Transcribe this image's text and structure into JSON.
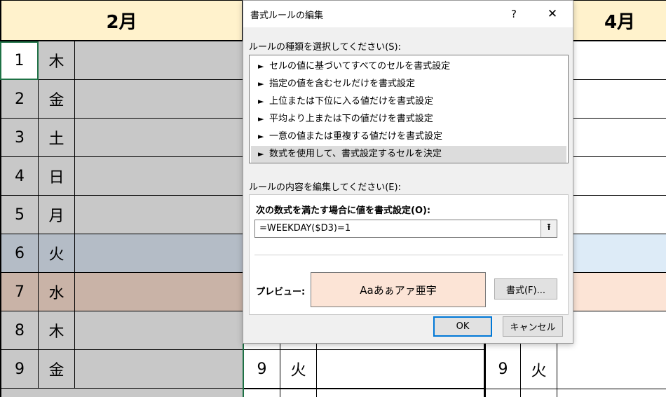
{
  "sheet": {
    "month_left": "2月",
    "month_right": "4月",
    "left_rows": [
      {
        "num": "1",
        "day": "木"
      },
      {
        "num": "2",
        "day": "金"
      },
      {
        "num": "3",
        "day": "土"
      },
      {
        "num": "4",
        "day": "日"
      },
      {
        "num": "5",
        "day": "月"
      },
      {
        "num": "6",
        "day": "火"
      },
      {
        "num": "7",
        "day": "水"
      },
      {
        "num": "8",
        "day": "木"
      },
      {
        "num": "9",
        "day": "金"
      }
    ],
    "mid_row9": {
      "num": "9",
      "day": "火"
    },
    "right_row9": {
      "num": "9",
      "day": "火"
    }
  },
  "dialog": {
    "title": "書式ルールの編集",
    "help": "?",
    "close": "✕",
    "rule_type_label": "ルールの種類を選択してください(S):",
    "rule_types": [
      "セルの値に基づいてすべてのセルを書式設定",
      "指定の値を含むセルだけを書式設定",
      "上位または下位に入る値だけを書式設定",
      "平均より上または下の値だけを書式設定",
      "一意の値または重複する値だけを書式設定",
      "数式を使用して、書式設定するセルを決定"
    ],
    "arrow": "►",
    "edit_label": "ルールの内容を編集してください(E):",
    "formula_label": "次の数式を満たす場合に値を書式設定(O):",
    "formula_value": "=WEEKDAY($D3)=1",
    "collapse_icon": "⭱",
    "preview_label": "プレビュー:",
    "preview_text": "Aaあぁアァ亜宇",
    "format_button": "書式(F)...",
    "ok_button": "OK",
    "cancel_button": "キャンセル"
  },
  "colors": {
    "header_bg": "#fff2cc",
    "gray_fill": "#c8c8c8",
    "blue_fill": "#ddebf7",
    "peach_fill": "#fce4d6",
    "accent": "#0078d7"
  }
}
